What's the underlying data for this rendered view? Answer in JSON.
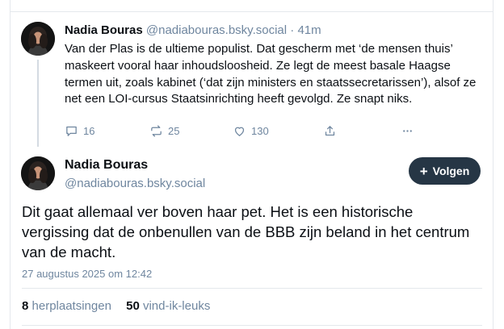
{
  "parent_post": {
    "author_name": "Nadia Bouras",
    "author_handle": "@nadiabouras.bsky.social",
    "separator": "·",
    "time_ago": "41m",
    "text": "Van der Plas is de ultieme populist. Dat gescherm met ‘de mensen thuis’ maskeert vooral haar inhoudsloosheid. Ze legt de meest basale Haagse termen uit, zoals kabinet (‘dat zijn ministers en staatssecretarissen’), alsof ze net een LOI-cursus Staatsinrichting heeft gevolgd. Ze snapt niks.",
    "actions": {
      "replies": "16",
      "reposts": "25",
      "likes": "130"
    }
  },
  "main_post": {
    "author_name": "Nadia Bouras",
    "author_handle": "@nadiabouras.bsky.social",
    "follow_label": "Volgen",
    "text": "Dit gaat allemaal ver boven haar pet. Het is een historische vergissing dat de onbenullen van de BBB zijn beland in het centrum van de macht.",
    "timestamp": "27 augustus 2025 om 12:42",
    "stats": {
      "reposts_count": "8",
      "reposts_label": "herplaatsingen",
      "likes_count": "50",
      "likes_label": "vind-ik-leuks"
    }
  },
  "icons": [
    "reply-icon",
    "repost-icon",
    "like-icon",
    "share-icon",
    "more-icon",
    "plus-icon"
  ],
  "colors": {
    "muted": "#6f869f",
    "text": "#0b0f14",
    "border": "#e4e8ec",
    "follow_bg": "#263645"
  }
}
